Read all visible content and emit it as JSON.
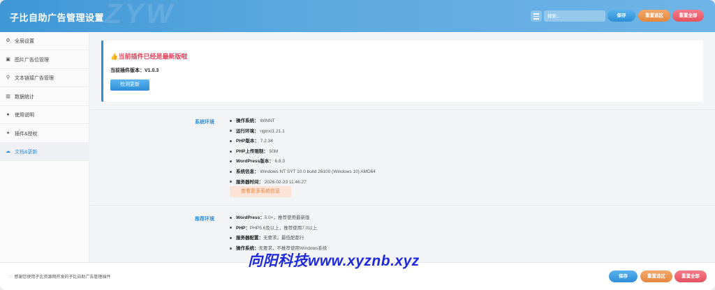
{
  "header": {
    "title": "子比自助广告管理设置",
    "watermark": "ZYW",
    "search_placeholder": "搜索...",
    "save_label": "保存",
    "reset_section_label": "重置选区",
    "reset_all_label": "重置全部"
  },
  "sidebar": {
    "items": [
      {
        "label": "全局设置",
        "icon": "gear-icon",
        "glyph": "⚙"
      },
      {
        "label": "图片广告位管理",
        "icon": "image-icon",
        "glyph": "▣"
      },
      {
        "label": "文本链接广告管理",
        "icon": "link-icon",
        "glyph": "⚲"
      },
      {
        "label": "数据统计",
        "icon": "bar-chart-icon",
        "glyph": "▥"
      },
      {
        "label": "使用说明",
        "icon": "info-icon",
        "glyph": "●"
      },
      {
        "label": "插件&授权",
        "icon": "puzzle-icon",
        "glyph": "✦"
      },
      {
        "label": "文档&更新",
        "icon": "cloud-upload-icon",
        "glyph": "☁"
      }
    ],
    "active_index": 6
  },
  "notice": {
    "title": "当前插件已经是最新版啦",
    "version_label": "当前插件版本：",
    "version_value": "V1.0.3",
    "check_button": "检测更新"
  },
  "system_env": {
    "label": "系统环境",
    "items": [
      {
        "key": "操作系统：",
        "value": "WINNT"
      },
      {
        "key": "运行环境：",
        "value": "nginx/1.21.1"
      },
      {
        "key": "PHP版本：",
        "value": "7.2.34"
      },
      {
        "key": "PHP上传限制：",
        "value": "50M"
      },
      {
        "key": "WordPress版本：",
        "value": "6.8.3"
      },
      {
        "key": "系统信息：",
        "value": "Windows NT SYT 10.0 build 26100 (Windows 10) AMD64"
      },
      {
        "key": "服务器时间：",
        "value": "2026-02-23 11:46:27"
      }
    ],
    "more_button": "查看更多系统信息"
  },
  "recommended_env": {
    "label": "推荐环境",
    "items": [
      {
        "key": "WordPress：",
        "value": "5.0+，推荐使用最新版"
      },
      {
        "key": "PHP：",
        "value": "PHP5.6及以上，推荐使用7.0以上"
      },
      {
        "key": "服务器配置：",
        "value": "无要求，最低配都行"
      },
      {
        "key": "操作系统：",
        "value": "无要求，不推荐使用Windows系统"
      }
    ]
  },
  "footer": {
    "thanks": "感谢您使用子比资源网开发的子比自助广告管理插件",
    "save_label": "保存",
    "reset_section_label": "重置选区",
    "reset_all_label": "重置全部"
  },
  "brand_overlay": "向阳科技www.xyznb.xyz",
  "colors": {
    "primary": "#2d8fd8",
    "orange": "#e4873e",
    "red": "#e5515f",
    "notice_title": "#e0455c",
    "brand": "#1f2bd8"
  }
}
